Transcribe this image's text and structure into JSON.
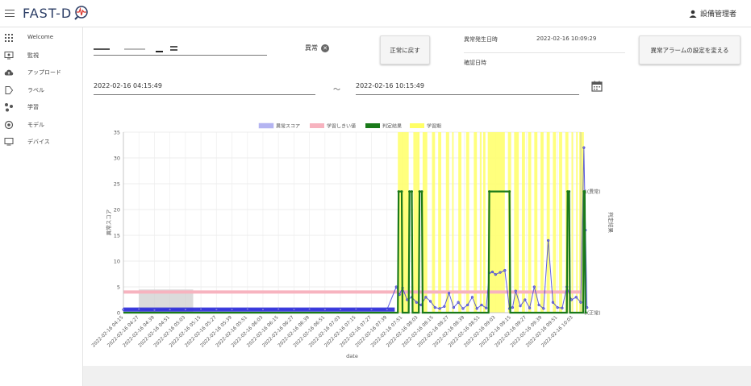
{
  "app": {
    "title": "FAST-D",
    "user": "設備管理者"
  },
  "sidebar": {
    "items": [
      {
        "label": "Welcome",
        "icon": "apps-grid-icon"
      },
      {
        "label": "監視",
        "icon": "monitor-icon"
      },
      {
        "label": "アップロード",
        "icon": "cloud-upload-icon"
      },
      {
        "label": "ラベル",
        "icon": "label-icon"
      },
      {
        "label": "学習",
        "icon": "learning-icon"
      },
      {
        "label": "モデル",
        "icon": "model-icon"
      },
      {
        "label": "デバイス",
        "icon": "device-icon"
      }
    ]
  },
  "filter": {
    "label": "異常"
  },
  "buttons": {
    "mark_normal": "正常に戻す",
    "alarm_settings": "異常アラームの設定を変える"
  },
  "info": {
    "occurred_label": "異常発生日時",
    "occurred_value": "2022-02-16 10:09:29",
    "confirmed_label": "確認日時",
    "confirmed_value": ""
  },
  "range": {
    "start": "2022-02-16 04:15:49",
    "separator": "～",
    "end": "2022-02-16 10:15:49"
  },
  "colors": {
    "anomaly_score": "#2b2bd9",
    "threshold": "#f7b3bf",
    "judgment": "#1a7a1a",
    "learning_period": "#ffff66"
  },
  "chart_data": {
    "type": "line",
    "xlabel": "date",
    "ylabel": "異常スコア",
    "y2label": "判定結果",
    "ylim": [
      0,
      35
    ],
    "yticks": [
      0,
      5,
      10,
      15,
      20,
      25,
      30,
      35
    ],
    "y2ticks": [
      "0(正常)",
      "1(異常)"
    ],
    "grid": true,
    "legend_position": "top",
    "legend": [
      "異常スコア",
      "学習しきい値",
      "判定結果",
      "学習期"
    ],
    "x_tick_labels": [
      "2022-02-16 04:15",
      "2022-02-16 04:27",
      "2022-02-16 04:39",
      "2022-02-16 04:51",
      "2022-02-16 05:03",
      "2022-02-16 05:15",
      "2022-02-16 05:27",
      "2022-02-16 05:39",
      "2022-02-16 05:51",
      "2022-02-16 06:03",
      "2022-02-16 06:15",
      "2022-02-16 06:27",
      "2022-02-16 06:39",
      "2022-02-16 06:51",
      "2022-02-16 07:03",
      "2022-02-16 07:15",
      "2022-02-16 07:27",
      "2022-02-16 07:39",
      "2022-02-16 07:51",
      "2022-02-16 08:03",
      "2022-02-16 08:15",
      "2022-02-16 08:27",
      "2022-02-16 08:39",
      "2022-02-16 08:51",
      "2022-02-16 09:03",
      "2022-02-16 09:15",
      "2022-02-16 09:27",
      "2022-02-16 09:39",
      "2022-02-16 09:51",
      "2022-02-16 10:03"
    ],
    "threshold": 4,
    "gray_region": {
      "x_start": 1,
      "x_end": 4.5,
      "y_top": 4.5
    },
    "yellow_bands": [
      [
        17.7,
        18.4
      ],
      [
        18.7,
        19.1
      ],
      [
        19.3,
        19.6
      ],
      [
        19.9,
        20.1
      ],
      [
        20.3,
        20.5
      ],
      [
        20.8,
        21.0
      ],
      [
        21.2,
        21.3
      ],
      [
        21.6,
        21.8
      ],
      [
        22.1,
        22.3
      ],
      [
        22.6,
        22.8
      ],
      [
        23.0,
        23.1
      ],
      [
        23.2,
        23.35
      ],
      [
        23.5,
        24.6
      ],
      [
        24.8,
        25.0
      ],
      [
        25.2,
        25.5
      ],
      [
        25.7,
        25.9
      ],
      [
        26.1,
        26.3
      ],
      [
        26.5,
        26.7
      ],
      [
        26.9,
        27.1
      ],
      [
        27.3,
        27.5
      ],
      [
        27.7,
        27.9
      ],
      [
        28.1,
        28.3
      ],
      [
        28.5,
        28.7
      ],
      [
        28.9,
        29.0
      ],
      [
        29.2,
        29.3
      ],
      [
        29.4,
        29.7
      ]
    ],
    "judgment_steps": [
      [
        0,
        0
      ],
      [
        17.7,
        0
      ],
      [
        17.75,
        1
      ],
      [
        17.95,
        1
      ],
      [
        18.0,
        0
      ],
      [
        18.4,
        0
      ],
      [
        18.45,
        1
      ],
      [
        18.6,
        1
      ],
      [
        18.65,
        0
      ],
      [
        19.05,
        0
      ],
      [
        19.1,
        1
      ],
      [
        19.25,
        1
      ],
      [
        19.3,
        0
      ],
      [
        23.55,
        0
      ],
      [
        23.6,
        1
      ],
      [
        24.9,
        1
      ],
      [
        24.95,
        0
      ],
      [
        28.6,
        0
      ],
      [
        28.65,
        1
      ],
      [
        28.75,
        1
      ],
      [
        28.8,
        0
      ],
      [
        29.65,
        0
      ],
      [
        29.7,
        1
      ],
      [
        29.75,
        1
      ],
      [
        29.8,
        0
      ],
      [
        29.9,
        0
      ]
    ],
    "series": [
      {
        "name": "異常スコア",
        "x": [
          0,
          1,
          2,
          3,
          4,
          5,
          6,
          7,
          8,
          9,
          10,
          11,
          12,
          13,
          14,
          15,
          16,
          17,
          17.6,
          17.8,
          18.0,
          18.3,
          18.6,
          18.9,
          19.2,
          19.5,
          19.8,
          20.1,
          20.4,
          20.7,
          21.0,
          21.3,
          21.6,
          21.9,
          22.2,
          22.5,
          22.8,
          23.1,
          23.4,
          23.6,
          23.8,
          24.0,
          24.3,
          24.6,
          24.9,
          25.1,
          25.3,
          25.6,
          25.9,
          26.2,
          26.5,
          26.8,
          27.1,
          27.4,
          27.7,
          28.0,
          28.3,
          28.6,
          28.9,
          29.2,
          29.5,
          29.7,
          29.8,
          29.9
        ],
        "values": [
          0.6,
          0.7,
          0.5,
          0.6,
          0.6,
          0.7,
          0.6,
          0.6,
          0.7,
          0.6,
          0.7,
          0.6,
          0.7,
          0.6,
          0.6,
          0.7,
          0.6,
          0.6,
          5.0,
          3.5,
          4.8,
          2.5,
          3.0,
          2.0,
          1.5,
          3.0,
          2.2,
          1.0,
          0.8,
          1.2,
          3.8,
          1.0,
          2.0,
          0.8,
          1.5,
          3.0,
          0.8,
          1.5,
          0.9,
          7.7,
          7.9,
          7.4,
          7.8,
          8.2,
          0.8,
          1.0,
          4.2,
          1.3,
          2.5,
          0.9,
          5.0,
          1.5,
          0.8,
          14.0,
          2.0,
          1.0,
          0.9,
          5.0,
          2.5,
          3.0,
          2.0,
          32.0,
          16.0,
          1.0
        ]
      }
    ]
  }
}
